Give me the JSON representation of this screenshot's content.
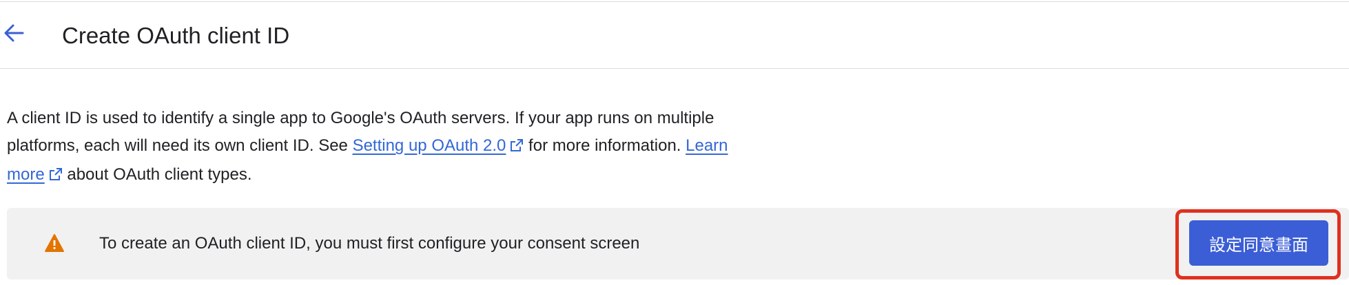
{
  "header": {
    "back_icon": "arrow-back-icon",
    "title": "Create OAuth client ID"
  },
  "description": {
    "text_1": "A client ID is used to identify a single app to Google's OAuth servers. If your app runs on multiple platforms, each will need its own client ID. See ",
    "link_1": "Setting up OAuth 2.0",
    "text_2": " for more information. ",
    "link_2": "Learn more",
    "text_3": " about OAuth client types.",
    "external_icon": "open-in-new-icon"
  },
  "banner": {
    "icon": "warning-icon",
    "message": "To create an OAuth client ID, you must first configure your consent screen",
    "button_label": "設定同意畫面"
  },
  "colors": {
    "accent": "#3b5ed6",
    "link": "#3367d6",
    "warning": "#e37400",
    "highlight": "#e0301e",
    "banner_bg": "#f1f1f1"
  }
}
